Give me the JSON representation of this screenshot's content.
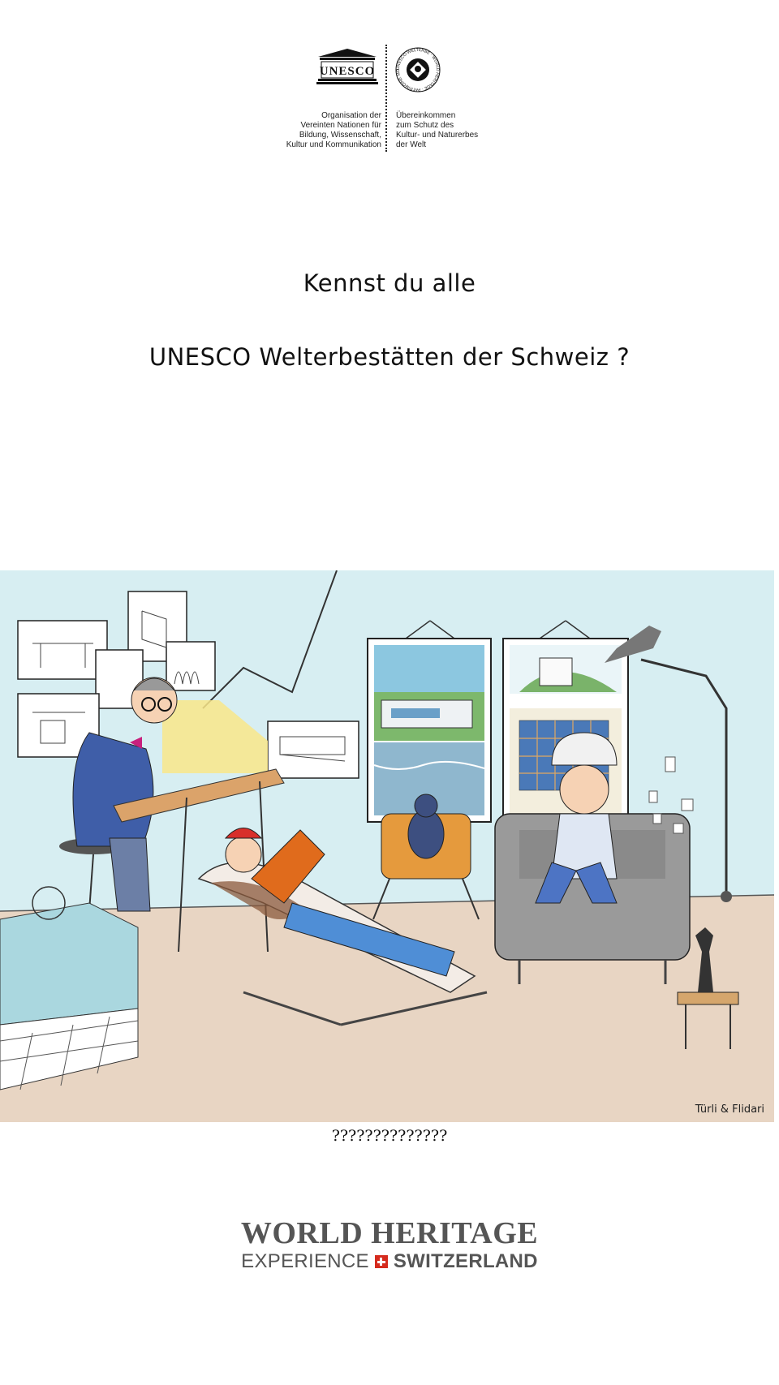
{
  "header": {
    "unesco_logo": {
      "wordmark": "UNESCO",
      "caption_lines": [
        "Organisation der",
        "Vereinten Nationen für",
        "Bildung, Wissenschaft,",
        "Kultur und Kommunikation"
      ]
    },
    "whc_logo": {
      "emblem_text": "UNESCO-WELTERBE · WORLD HERITAGE · PATRIMOINE MONDIAL",
      "caption_lines": [
        "Übereinkommen",
        "zum Schutz des",
        "Kultur- und Naturerbes",
        "der Welt"
      ]
    }
  },
  "title": {
    "line1": "Kennst du alle",
    "line2": "UNESCO Welterbestätten der Schweiz ?"
  },
  "illustration": {
    "signature": "Türli & Flidari"
  },
  "caption": "??????????????",
  "footer_logo": {
    "line1": "WORLD HERITAGE",
    "line2_left": "EXPERIENCE",
    "line2_right": "SWITZERLAND"
  },
  "colors": {
    "wall": "#d7eef2",
    "floor": "#e7d4c2",
    "logo_grey": "#555555",
    "swiss_red": "#d52b1e"
  }
}
